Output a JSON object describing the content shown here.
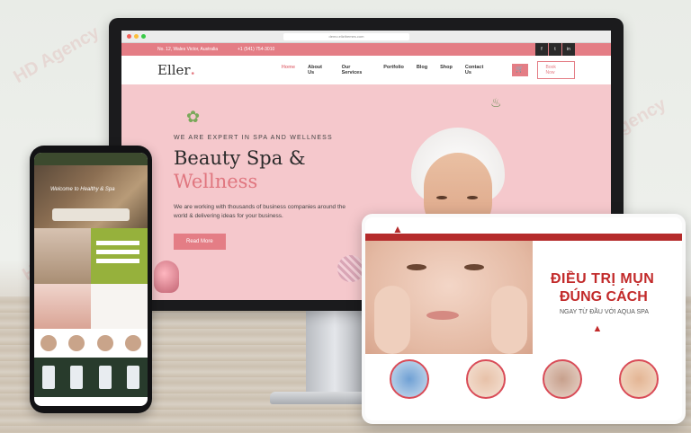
{
  "desktop": {
    "browser": {
      "url": "demo.elizthemes.com"
    },
    "topbar": {
      "address": "No. 12, Wales Victor, Australia",
      "phone": "+1 (541) 754-3010",
      "social_icons": [
        "facebook-icon",
        "twitter-icon",
        "linkedin-icon"
      ],
      "social_glyphs": [
        "f",
        "t",
        "in"
      ]
    },
    "navbar": {
      "logo": "Eller",
      "logo_dot": ".",
      "items": [
        "Home",
        "About Us",
        "Our Services",
        "Portfolio",
        "Blog",
        "Shop",
        "Contact Us"
      ],
      "active_index": 0,
      "book_button": "Book Now"
    },
    "hero": {
      "tagline": "WE ARE EXPERT IN SPA AND WELLNESS",
      "title_line1": "Beauty Spa &",
      "title_line2": "Wellness",
      "description": "We are working with thousands of business companies around the world & delivering ideas for your business.",
      "button": "Read More"
    },
    "colors": {
      "accent": "#e47d85",
      "hero_bg": "#f5c8cc"
    }
  },
  "phone": {
    "hero_title": "Welcome to Healthy & Spa"
  },
  "tablet": {
    "headline_line1": "ĐIỀU TRỊ MỤN",
    "headline_line2": "ĐÚNG CÁCH",
    "subheadline": "NGAY TỪ ĐẦU VỚI AQUA SPA",
    "colors": {
      "brand": "#c22a2a"
    }
  },
  "watermark": "HD Agency"
}
